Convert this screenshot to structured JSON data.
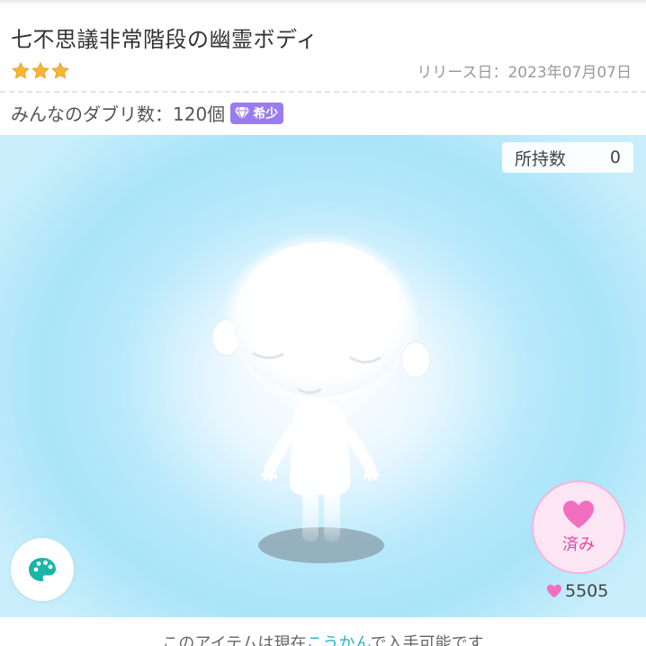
{
  "item": {
    "title": "七不思議非常階段の幽霊ボディ",
    "stars": 3,
    "release_label": "リリース日：2023年07月07日",
    "duplicate_label": "みんなのダブリ数：120個",
    "rarity_label": "希少"
  },
  "owned": {
    "label": "所持数",
    "value": "0"
  },
  "like": {
    "label": "済み",
    "count": "5505"
  },
  "footer": {
    "prefix": "このアイテムは現在",
    "link": "こうかん",
    "suffix": "で入手可能です"
  },
  "colors": {
    "accent_pink": "#e24aa3",
    "star": "#f7b733",
    "rarity": "#9b7cf0",
    "link": "#23b3c9",
    "palette_icon": "#19b6a8"
  },
  "icons": {
    "star": "star-icon",
    "rarity": "diamond-icon",
    "palette": "palette-icon",
    "like": "heart-icon",
    "like_count": "small-heart-icon"
  }
}
